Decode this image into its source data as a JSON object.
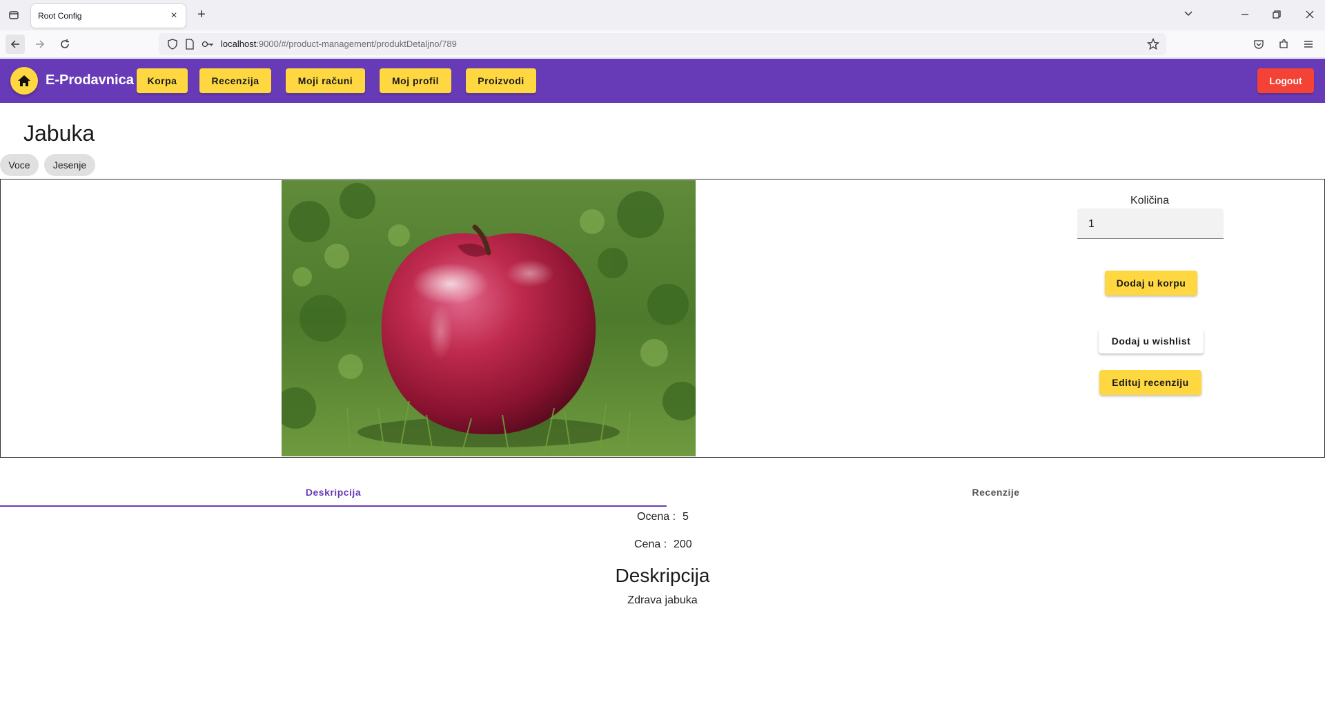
{
  "browser": {
    "tab_title": "Root Config",
    "url_host": "localhost",
    "url_rest": ":9000/#/product-management/produktDetaljno/789"
  },
  "header": {
    "brand": "E-Prodavnica",
    "nav": [
      "Korpa",
      "Recenzija",
      "Moji računi",
      "Moj profil",
      "Proizvodi"
    ],
    "logout": "Logout"
  },
  "product": {
    "title": "Jabuka",
    "tags": [
      "Voce",
      "Jesenje"
    ],
    "quantity_label": "Količina",
    "quantity_value": "1",
    "add_to_cart": "Dodaj u korpu",
    "add_to_wishlist": "Dodaj u wishlist",
    "edit_review": "Edituj recenziju"
  },
  "tabs": {
    "description": "Deskripcija",
    "reviews": "Recenzije"
  },
  "details": {
    "rating_label": "Ocena :",
    "rating_value": "5",
    "price_label": "Cena :",
    "price_value": "200",
    "description_heading": "Deskripcija",
    "description_text": "Zdrava jabuka"
  },
  "colors": {
    "primary": "#673ab7",
    "accent": "#ffd740",
    "warn": "#f44336"
  }
}
